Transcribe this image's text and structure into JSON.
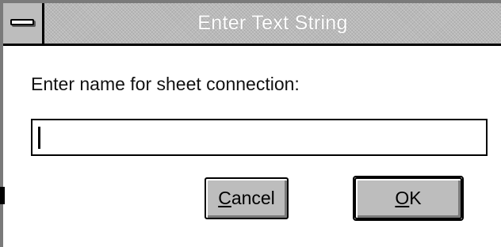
{
  "window": {
    "title": "Enter Text String"
  },
  "dialog": {
    "prompt": "Enter name for sheet connection:",
    "input": {
      "value": "",
      "placeholder": ""
    },
    "buttons": {
      "cancel": {
        "mnemonic": "C",
        "rest": "ancel"
      },
      "ok": {
        "mnemonic": "O",
        "rest": "K"
      }
    }
  },
  "icons": {
    "system_menu": "system-menu-icon"
  },
  "colors": {
    "titlebar": "#b9b9b9",
    "button_face": "#bdbdbd",
    "frame": "#000000"
  }
}
